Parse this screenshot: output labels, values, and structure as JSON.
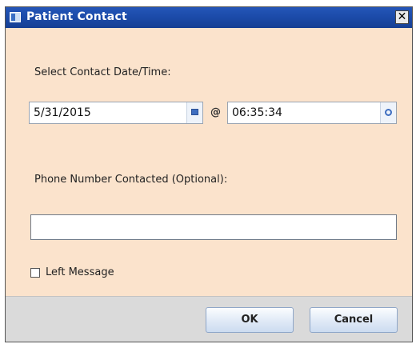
{
  "dialog": {
    "title": "Patient Contact",
    "close_glyph": "✕",
    "icon": "window-icon"
  },
  "contact": {
    "date_label": "Select Contact Date/Time:",
    "date_value": "5/31/2015",
    "at_symbol": "@",
    "time_value": "06:35:34",
    "phone_label": "Phone Number Contacted (Optional):",
    "phone_value": "",
    "left_message_label": "Left Message",
    "left_message_checked": false
  },
  "buttons": {
    "ok_label": "OK",
    "cancel_label": "Cancel"
  },
  "colors": {
    "dialog_background": "#fbe3cc",
    "titlebar": "#1b4aa8",
    "footer": "#dadada"
  }
}
